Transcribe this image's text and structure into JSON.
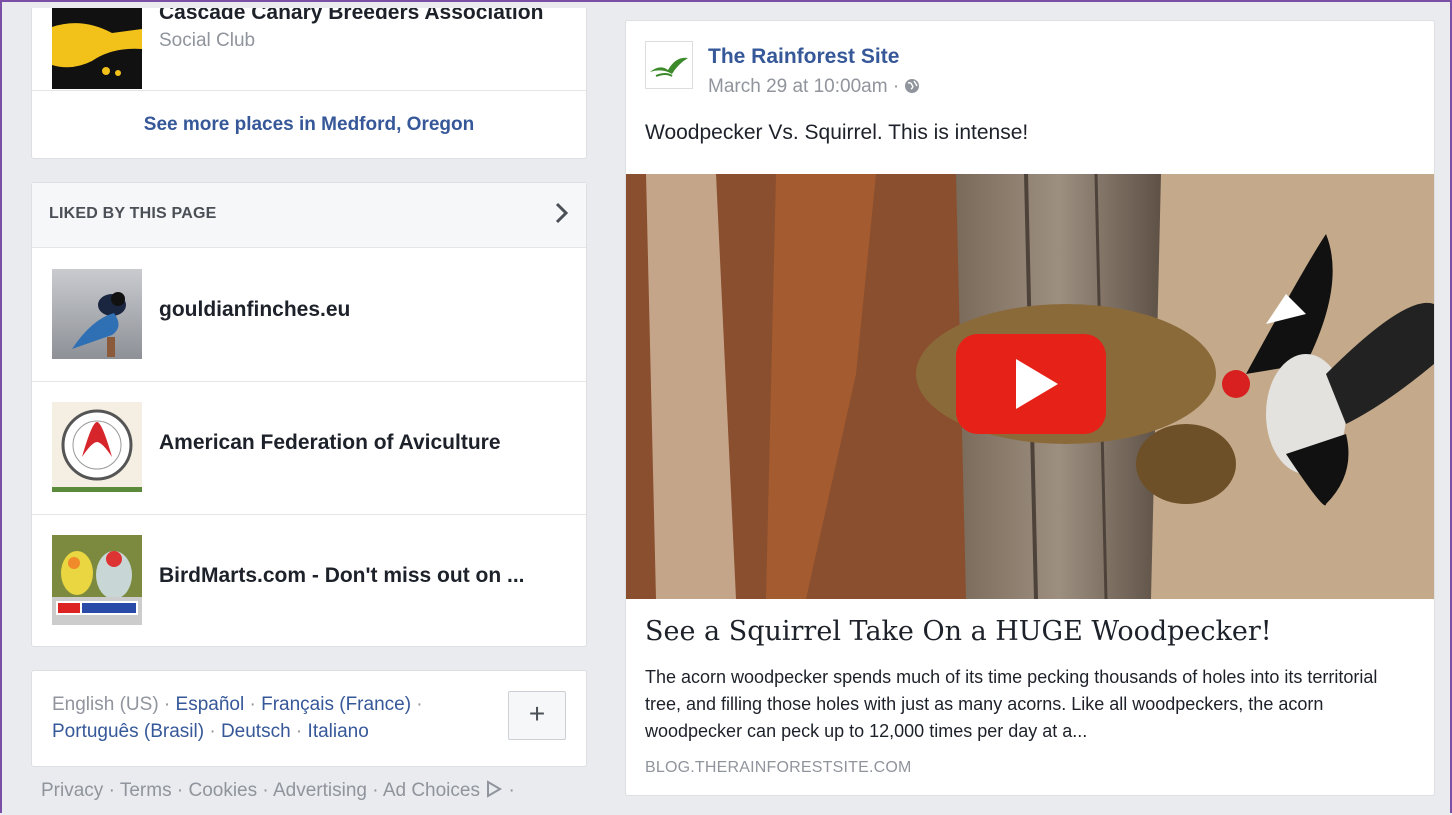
{
  "places": {
    "top_item": {
      "name": "Cascade Canary Breeders Association",
      "category": "Social Club"
    },
    "see_more_label": "See more places in Medford, Oregon"
  },
  "liked_by_page": {
    "title": "LIKED BY THIS PAGE",
    "chevron_icon": "chevron-right-icon",
    "items": [
      {
        "name": "gouldianfinches.eu"
      },
      {
        "name": "American Federation of Aviculture"
      },
      {
        "name": "BirdMarts.com - Don't miss out on ..."
      }
    ]
  },
  "languages": {
    "current": "English (US)",
    "options": [
      "Español",
      "Français (France)",
      "Português (Brasil)",
      "Deutsch",
      "Italiano"
    ],
    "add_label": "+"
  },
  "footer": {
    "links": [
      "Privacy",
      "Terms",
      "Cookies",
      "Advertising",
      "Ad Choices"
    ]
  },
  "post": {
    "author": "The Rainforest Site",
    "timestamp": "March 29 at 10:00am",
    "separator": "·",
    "privacy_icon": "globe-icon",
    "text": "Woodpecker Vs. Squirrel. This is intense!",
    "link": {
      "title": "See a Squirrel Take On a HUGE Woodpecker!",
      "description": "The acorn woodpecker spends much of its time pecking thousands of holes into its territorial tree, and filling those holes with just as many acorns. Like all woodpeckers, the acorn woodpecker can peck up to 12,000 times per day at a...",
      "domain": "BLOG.THERAINFORESTSITE.COM"
    },
    "play_icon": "youtube-play-icon"
  },
  "colors": {
    "link_blue": "#365899",
    "muted": "#90949c",
    "youtube_red": "#e62117",
    "frame_purple": "#7b4fa5"
  }
}
